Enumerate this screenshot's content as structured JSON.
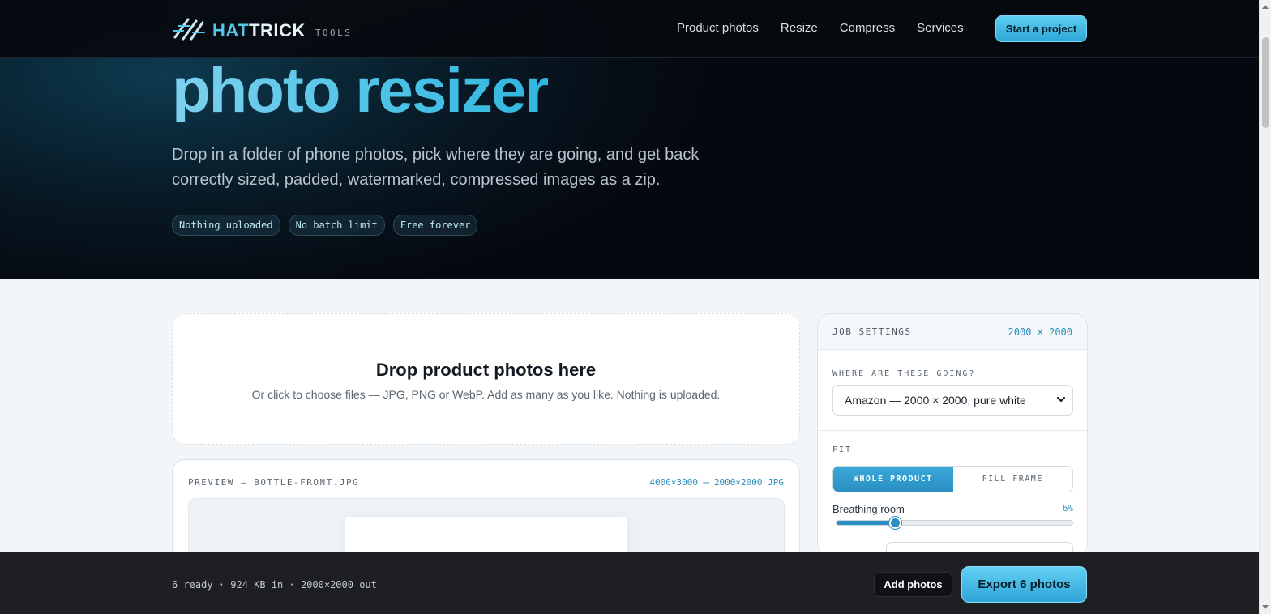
{
  "nav": {
    "logo_primary": "HAT",
    "logo_secondary": "TRICK",
    "logo_suffix": "TOOLS",
    "links": [
      "Product photos",
      "Resize",
      "Compress",
      "Services"
    ],
    "cta_label": "Start a project"
  },
  "hero": {
    "title": "photo resizer",
    "subtitle": "Drop in a folder of phone photos, pick where they are going, and get back correctly sized, padded, watermarked, compressed images as a zip.",
    "chips": [
      "Nothing uploaded",
      "No batch limit",
      "Free forever"
    ]
  },
  "dropzone": {
    "title": "Drop product photos here",
    "subtitle": "Or click to choose files — JPG, PNG or WebP. Add as many as you like. Nothing is uploaded."
  },
  "preview": {
    "label": "PREVIEW — BOTTLE-FRONT.JPG",
    "dims": "4000×3000 ⟶ 2000×2000 JPG"
  },
  "settings": {
    "header_label": "JOB SETTINGS",
    "header_dims": "2000 × 2000",
    "destination_label": "WHERE ARE THESE GOING?",
    "destination_value": "Amazon — 2000 × 2000, pure white",
    "fit_label": "FIT",
    "fit_options": [
      "WHOLE PRODUCT",
      "FILL FRAME"
    ],
    "fit_selected": 0,
    "breathing_label": "Breathing room",
    "breathing_value": "6%",
    "breathing_fraction": 0.25
  },
  "bottom_bar": {
    "status": "6 ready · 924 KB in · 2000×2000 out",
    "add_label": "Add photos",
    "export_label": "Export 6 photos"
  },
  "colors": {
    "accent": "#2a8fc2",
    "accent_light": "#53c6ea",
    "hero_bg": "#05080f",
    "page_bg": "#f3f6f9"
  }
}
